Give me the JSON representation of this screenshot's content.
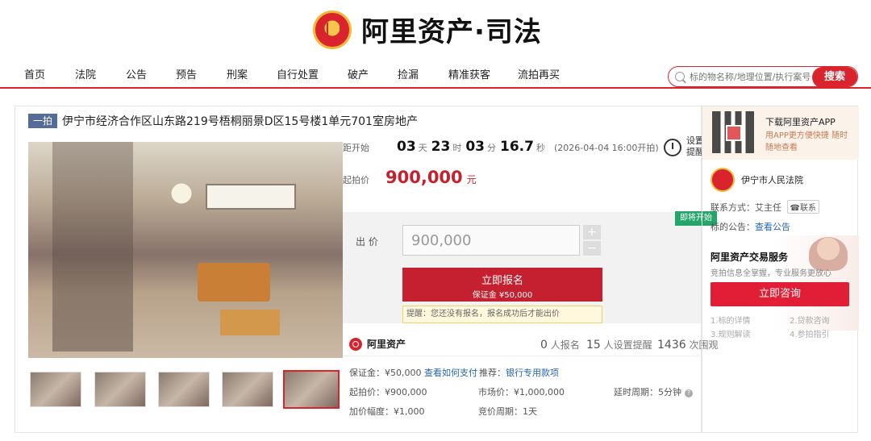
{
  "header": {
    "brand": "阿里资产·司法"
  },
  "nav": {
    "items": [
      "首页",
      "法院",
      "公告",
      "预告",
      "刑案",
      "自行处置",
      "破产",
      "捡漏",
      "精准获客",
      "流拍再买"
    ]
  },
  "search": {
    "placeholder": "标的物名称/地理位置/执行案号",
    "button": "搜索"
  },
  "listing": {
    "tag": "一拍",
    "title": "伊宁市经济合作区山东路219号梧桐丽景D区15号楼1单元701室房地产",
    "countdown": {
      "label": "距开始",
      "days": "03",
      "day_unit": "天",
      "hours": "23",
      "hour_unit": "时",
      "minutes": "03",
      "minute_unit": "分",
      "seconds": "16.7",
      "second_unit": "秒",
      "start": "(2026-04-04 16:00开拍)"
    },
    "alarm": {
      "label": "设置提醒"
    },
    "start_price": {
      "label": "起拍价",
      "value": "900,000",
      "unit": "元"
    },
    "bid": {
      "badge": "即将开始",
      "label": "出  价",
      "value": "900,000",
      "plus": "+",
      "minus": "−",
      "button_main": "立即报名",
      "button_sub": "保证金 ¥50,000",
      "tip": "提醒：您还没有报名，报名成功后才能出价"
    },
    "stats": {
      "brand": "阿里资产",
      "registrants": "0",
      "registrants_label": "人报名",
      "reminders": "15",
      "reminders_label": "人设置提醒",
      "views": "1436",
      "views_label": "次围观"
    },
    "details": {
      "deposit_label": "保证金：",
      "deposit": "¥50,000",
      "how_to_pay": "查看如何支付",
      "recommend_label": "推荐：",
      "recommend": "银行专用款项",
      "start_label": "起拍价：",
      "start": "¥900,000",
      "market_label": "市场价：",
      "market": "¥1,000,000",
      "delay_label": "延时周期：",
      "delay": "5分钟",
      "increment_label": "加价幅度：",
      "increment": "¥1,000",
      "cycle_label": "竞价周期：",
      "cycle": "1天"
    }
  },
  "sidebar": {
    "app_title": "下载阿里资产APP",
    "app_desc": "用APP更方便快捷 随时随地查看",
    "court_name": "伊宁市人民法院",
    "contact_label": "联系方式：艾主任",
    "contact_button": "联系",
    "notice_label": "标的公告：",
    "notice_link": "查看公告",
    "service_title": "阿里资产交易服务",
    "service_desc": "竞拍信息全掌握，专业服务更放心",
    "consult_button": "立即咨询",
    "faq": [
      "1.标的详情",
      "2.贷款咨询",
      "3.规则解读",
      "4.参拍指引"
    ]
  },
  "colors": {
    "accent": "#d9232d",
    "tag": "#536c99",
    "status_green": "#24a56b"
  },
  "icons": [
    "court-emblem-icon",
    "search-icon",
    "zoom-icon",
    "alarm-clock-icon",
    "qr-code-icon",
    "phone-icon",
    "question-icon"
  ]
}
